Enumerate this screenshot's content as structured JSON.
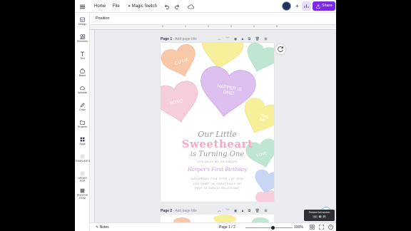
{
  "topbar": {
    "home_label": "Home",
    "file_label": "File",
    "magic_switch_label": "Magic Switch",
    "share_label": "Share"
  },
  "subbar": {
    "position_label": "Position"
  },
  "rail": {
    "items": [
      {
        "label": "Design",
        "icon": "design-icon"
      },
      {
        "label": "Elements",
        "icon": "elements-icon"
      },
      {
        "label": "Text",
        "icon": "text-icon"
      },
      {
        "label": "Brand",
        "icon": "brand-icon"
      },
      {
        "label": "Uploads",
        "icon": "uploads-icon"
      },
      {
        "label": "Draw",
        "icon": "draw-icon"
      },
      {
        "label": "Projects",
        "icon": "projects-icon"
      },
      {
        "label": "Apps",
        "icon": "apps-icon"
      },
      {
        "label": "TEMPLATES",
        "icon": "templates-icon"
      },
      {
        "label": "UPDER POP",
        "icon": "upder-pop-icon"
      },
      {
        "label": "PHOTOS ROM",
        "icon": "photos-rom-icon"
      }
    ]
  },
  "ruler": {
    "marks": [
      "0",
      "1",
      "2",
      "3",
      "4",
      "5"
    ]
  },
  "page1": {
    "label": "Page 1",
    "add_title": "Add page title",
    "hearts": [
      "CUTIE",
      "HAPPER IS ONE!",
      "XOXO",
      "HUG ME",
      "LOVE"
    ],
    "title_line1": "Our Little",
    "title_line2": "Sweetheart",
    "title_line3": "is Turning One",
    "join_text": "JOIN US AS WE CELEBRATE",
    "birthday_text": "Harper's First Birthday",
    "date_text": "SATURDAY FEB 20TH | AT 3PM",
    "address_text": "1234 HEART LN, GREAT FALLS, MT",
    "rsvp_text": "RSVP TO SARA AT 555-123-4567"
  },
  "page2": {
    "label": "Page 2",
    "add_title": "Add page title"
  },
  "bottombar": {
    "notes_label": "Notes",
    "page_indicator": "Page 1 / 2",
    "zoom": "100%"
  },
  "tooltip": {
    "text": "Present full screen",
    "keys": [
      "⌥",
      "⌘",
      "P"
    ]
  },
  "colors": {
    "accent": "#7d2ae8",
    "pink": "#f4c6d4",
    "lavender": "#d5b8ef",
    "mint": "#bfe6d2",
    "peach": "#f8c9a8",
    "yellow": "#f8ef9a",
    "blue": "#c6d6f3"
  }
}
